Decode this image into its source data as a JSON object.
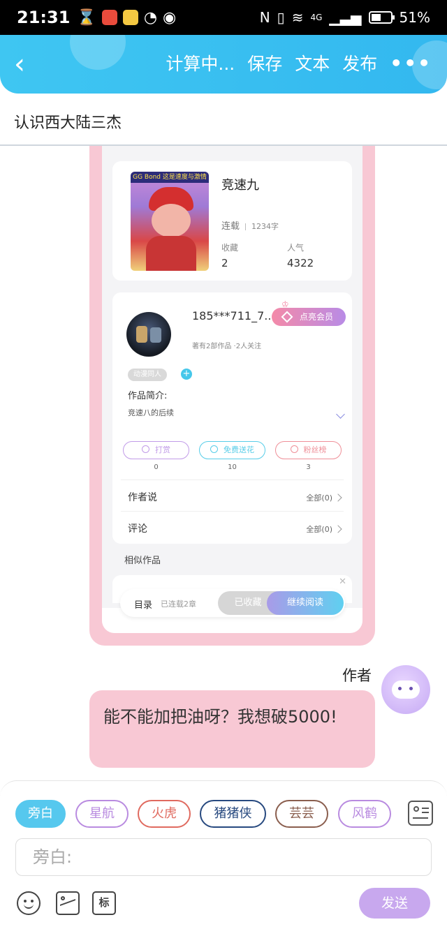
{
  "status_bar": {
    "time": "21:31",
    "network": "4G",
    "battery": "51%"
  },
  "appbar": {
    "actions": [
      "计算中...",
      "保存",
      "文本",
      "发布"
    ]
  },
  "doc_title": "认识西大陆三杰",
  "preview": {
    "book": {
      "cover_caption": "GG Bond 这是速度与激情",
      "title": "竞速九",
      "status": "连载",
      "words": "1234字",
      "stats": [
        {
          "label": "收藏",
          "value": "2"
        },
        {
          "label": "人气",
          "value": "4322"
        }
      ]
    },
    "author": {
      "name": "185***711_7...",
      "vip_label": "点亮会员",
      "meta": "著有2部作品 ·2人关注",
      "tag": "动漫同人",
      "intro_label": "作品简介:",
      "intro_text": "竞速八的后续",
      "actions": [
        {
          "label": "打赏",
          "count": "0",
          "color": "#c19be8"
        },
        {
          "label": "免费送花",
          "count": "10",
          "color": "#57cde8"
        },
        {
          "label": "粉丝榜",
          "count": "3",
          "color": "#ef8f98"
        }
      ],
      "rows": [
        {
          "label": "作者说",
          "right": "全部(0)"
        },
        {
          "label": "评论",
          "right": "全部(0)"
        }
      ]
    },
    "similar_label": "相似作品",
    "bottom_bar": {
      "catalog": "目录",
      "chapters": "已连载2章",
      "favorited": "已收藏",
      "continue": "继续阅读"
    }
  },
  "chat": {
    "speaker": "作者",
    "message": "能不能加把油呀？我想破5000!"
  },
  "input_panel": {
    "roles": [
      {
        "label": "旁白",
        "color": "#56c8ee",
        "active": true
      },
      {
        "label": "星航",
        "color": "#b98be0"
      },
      {
        "label": "火虎",
        "color": "#e06a5f"
      },
      {
        "label": "猪猪侠",
        "color": "#27497f"
      },
      {
        "label": "芸芸",
        "color": "#8a5e4e"
      },
      {
        "label": "风鹤",
        "color": "#b98be0"
      }
    ],
    "placeholder": "旁白:",
    "tag_tool_label": "标",
    "send_label": "发送"
  }
}
